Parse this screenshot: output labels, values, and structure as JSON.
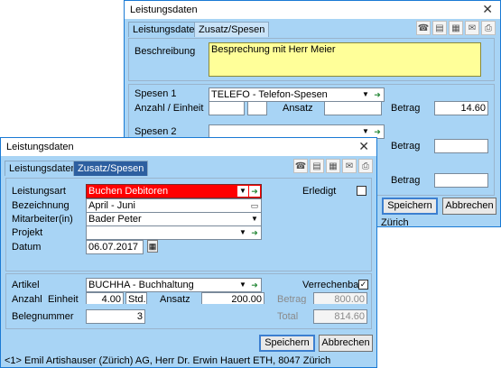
{
  "back_window": {
    "title": "Leistungsdaten",
    "tabs": [
      "Leistungsdaten",
      "Zusatz/Spesen"
    ],
    "beschreibung_label": "Beschreibung",
    "beschreibung_value": "Besprechung mit Herr Meier",
    "spesen1_label": "Spesen 1",
    "spesen1_value": "TELEFO - Telefon-Spesen",
    "anzahl_label": "Anzahl / Einheit",
    "ansatz_label": "Ansatz",
    "betrag_label": "Betrag",
    "betrag1_value": "14.60",
    "spesen2_label": "Spesen 2",
    "betrag2_label": "Betrag",
    "betrag3_label": "Betrag",
    "save_label": "Speichern",
    "cancel_label": "Abbrechen",
    "status_partial": "Zürich"
  },
  "front_window": {
    "title": "Leistungsdaten",
    "tabs": [
      "Leistungsdaten",
      "Zusatz/Spesen"
    ],
    "leistungsart_label": "Leistungsart",
    "leistungsart_value": "Buchen Debitoren",
    "erledigt_label": "Erledigt",
    "bezeichnung_label": "Bezeichnung",
    "bezeichnung_value": "April - Juni",
    "mitarbeiter_label": "Mitarbeiter(in)",
    "mitarbeiter_value": "Bader Peter",
    "projekt_label": "Projekt",
    "projekt_value": "",
    "datum_label": "Datum",
    "datum_value": "06.07.2017",
    "artikel_label": "Artikel",
    "artikel_value": "BUCHHA - Buchhaltung",
    "verrechenbar_label": "Verrechenbar",
    "verrechenbar_checked": "✓",
    "anzahl_label": "Anzahl",
    "einheit_label": "Einheit",
    "anzahl_value": "4.00",
    "einheit_value": "Std.",
    "ansatz_label": "Ansatz",
    "ansatz_value": "200.00",
    "betrag_label": "Betrag",
    "betrag_value": "800.00",
    "belegnummer_label": "Belegnummer",
    "belegnummer_value": "3",
    "total_label": "Total",
    "total_value": "814.60",
    "save_label": "Speichern",
    "cancel_label": "Abbrechen",
    "status_text": "<1> Emil Artishauser (Zürich) AG, Herr Dr. Erwin Hauert ETH, 8047 Zürich"
  },
  "colors": {
    "window_bg": "#a8d4f5",
    "leistungsart_bg": "#ff0000",
    "beschreibung_bg": "#ffff99",
    "tab_selected": "#2d5fa0"
  }
}
